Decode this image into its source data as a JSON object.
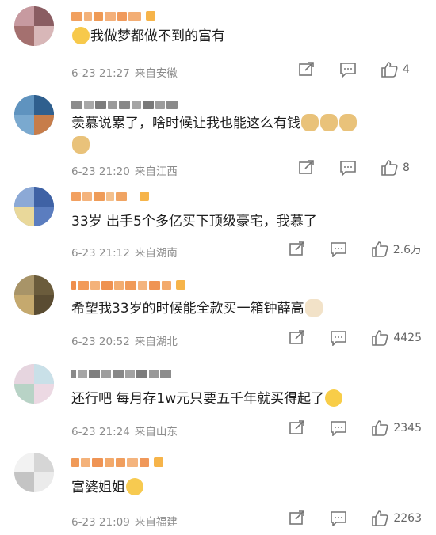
{
  "comments": [
    {
      "text": "我做梦都做不到的富有",
      "date": "6-23 21:27",
      "place": "来自安徽",
      "likes": "4",
      "emoji_lead": "crying-face",
      "emoji_trail": []
    },
    {
      "text": "羡慕说累了，啥时候让我也能这么有钱",
      "date": "6-23 21:20",
      "place": "来自江西",
      "likes": "8",
      "emoji_trail": [
        "doge",
        "doge",
        "doge",
        "doge"
      ]
    },
    {
      "text": "33岁 出手5个多亿买下顶级豪宅，我慕了",
      "date": "6-23 21:12",
      "place": "来自湖南",
      "likes": "2.6万",
      "emoji_trail": []
    },
    {
      "text": "希望我33岁的时候能全款买一箱钟薛高",
      "date": "6-23 20:52",
      "place": "来自湖北",
      "likes": "4425",
      "emoji_trail": [
        "cat"
      ]
    },
    {
      "text": "还行吧 每月存1w元只要五千年就买得起了",
      "date": "6-23 21:24",
      "place": "来自山东",
      "likes": "2345",
      "emoji_trail": [
        "smile"
      ]
    },
    {
      "text": "富婆姐姐",
      "date": "6-23 21:09",
      "place": "来自福建",
      "likes": "2263",
      "emoji_trail": [
        "rolling-eyes"
      ]
    }
  ],
  "icons": {
    "share": "share-icon",
    "comment": "comment-icon",
    "like": "thumbs-up-icon"
  },
  "colors": {
    "name": "#f0a24a",
    "meta": "#8c8c8c",
    "text": "#1d1d1d"
  }
}
